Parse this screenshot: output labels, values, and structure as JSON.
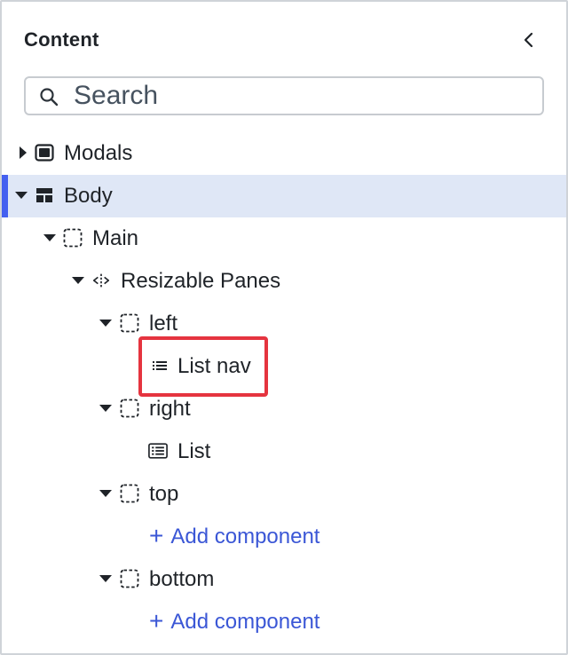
{
  "header": {
    "title": "Content",
    "collapse_icon": "chevron-left-icon"
  },
  "search": {
    "placeholder": "Search",
    "value": ""
  },
  "tree": {
    "modals": {
      "label": "Modals",
      "icon": "modal-icon",
      "expanded": false
    },
    "body": {
      "label": "Body",
      "icon": "layout-icon",
      "expanded": true,
      "selected": true
    },
    "main": {
      "label": "Main",
      "icon": "container-icon",
      "expanded": true
    },
    "resizable_panes": {
      "label": "Resizable Panes",
      "icon": "resize-handle-icon",
      "expanded": true
    },
    "left": {
      "label": "left",
      "icon": "container-icon",
      "expanded": true
    },
    "list_nav": {
      "label": "List nav",
      "icon": "list-icon",
      "highlighted": true
    },
    "right": {
      "label": "right",
      "icon": "container-icon",
      "expanded": true
    },
    "list": {
      "label": "List",
      "icon": "table-list-icon"
    },
    "top": {
      "label": "top",
      "icon": "container-icon",
      "expanded": true
    },
    "top_add": {
      "label": "Add component"
    },
    "bottom": {
      "label": "bottom",
      "icon": "container-icon",
      "expanded": true
    },
    "bottom_add": {
      "label": "Add component"
    }
  },
  "colors": {
    "selected_bg": "#dfe7f6",
    "selected_bar": "#4460f0",
    "link": "#3b57d6",
    "highlight": "#e5343f"
  }
}
